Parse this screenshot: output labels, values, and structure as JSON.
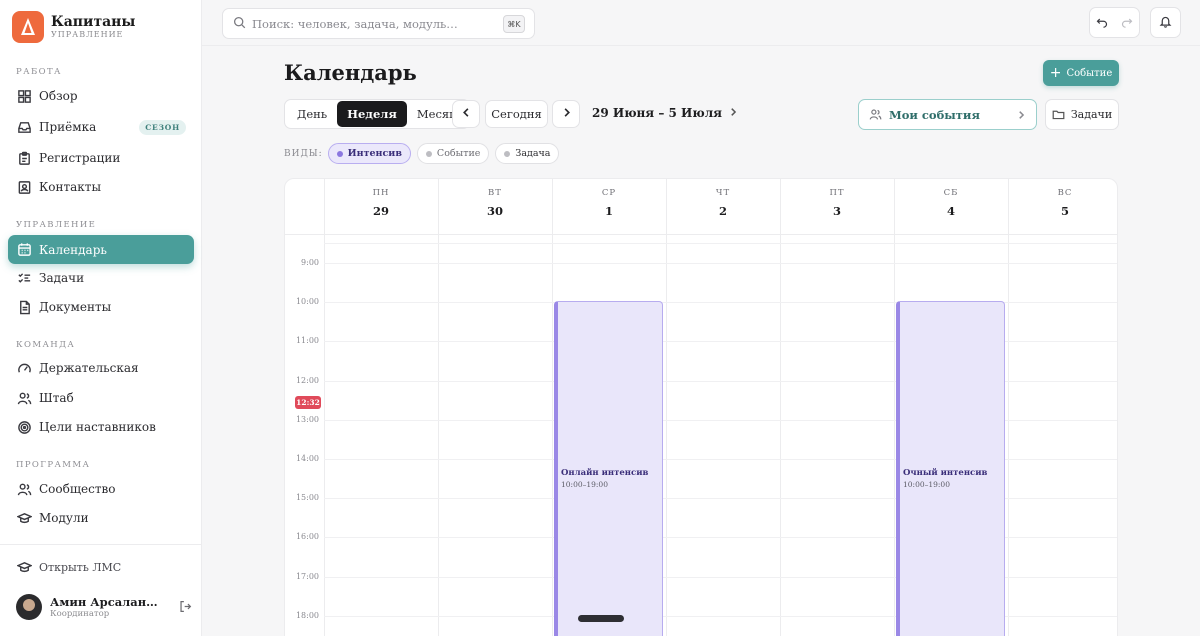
{
  "brand": {
    "title": "Капитаны",
    "subtitle": "УПРАВЛЕНИЕ",
    "color": "#ee6a3d"
  },
  "sidebar": {
    "sections": {
      "work": "РАБОТА",
      "management": "УПРАВЛЕНИЕ",
      "team": "КОМАНДА",
      "program": "ПРОГРАММА"
    },
    "items": [
      {
        "label": "Обзор",
        "icon": "grid-icon"
      },
      {
        "label": "Приёмка",
        "icon": "inbox-icon",
        "badge": "СЕЗОН"
      },
      {
        "label": "Регистрации",
        "icon": "clipboard-icon"
      },
      {
        "label": "Контакты",
        "icon": "contact-icon"
      },
      {
        "label": "Календарь",
        "icon": "calendar-icon",
        "active": true
      },
      {
        "label": "Задачи",
        "icon": "checklist-icon"
      },
      {
        "label": "Документы",
        "icon": "document-icon"
      },
      {
        "label": "Держательская",
        "icon": "gauge-icon"
      },
      {
        "label": "Штаб",
        "icon": "users-icon"
      },
      {
        "label": "Цели наставников",
        "icon": "target-icon"
      },
      {
        "label": "Сообщество",
        "icon": "users-icon"
      },
      {
        "label": "Модули",
        "icon": "graduation-cap-icon"
      }
    ],
    "open_lms": "Открыть ЛМС",
    "user": {
      "name": "Амин Арсалан Ха...",
      "role": "Координатор"
    }
  },
  "topbar": {
    "search_placeholder": "Поиск: человек, задача, модуль…",
    "shortcut": "⌘K"
  },
  "main": {
    "title": "Календарь",
    "new_event": "Событие",
    "view_modes": [
      "День",
      "Неделя",
      "Месяц"
    ],
    "active_view": "Неделя",
    "today": "Сегодня",
    "range": "29 Июня – 5 Июля",
    "my_events": "Мои события",
    "tasks": "Задачи",
    "views_label": "ВИДЫ:",
    "chips": [
      "Интенсив",
      "Событие",
      "Задача"
    ]
  },
  "calendar": {
    "days": [
      {
        "dow": "ПН",
        "num": "29"
      },
      {
        "dow": "ВТ",
        "num": "30"
      },
      {
        "dow": "СР",
        "num": "1"
      },
      {
        "dow": "ЧТ",
        "num": "2"
      },
      {
        "dow": "ПТ",
        "num": "3"
      },
      {
        "dow": "СБ",
        "num": "4"
      },
      {
        "dow": "ВС",
        "num": "5"
      }
    ],
    "hours": [
      "9:00",
      "10:00",
      "11:00",
      "12:00",
      "13:00",
      "14:00",
      "15:00",
      "16:00",
      "17:00",
      "18:00"
    ],
    "now": "12:32",
    "events": [
      {
        "title": "Онлайн интенсив",
        "time": "10:00–19:00",
        "day_index": 2
      },
      {
        "title": "Очный интенсив",
        "time": "10:00–19:00",
        "day_index": 5
      }
    ],
    "accent": "#4a9e9a",
    "event_color": "#e9e6fa"
  }
}
